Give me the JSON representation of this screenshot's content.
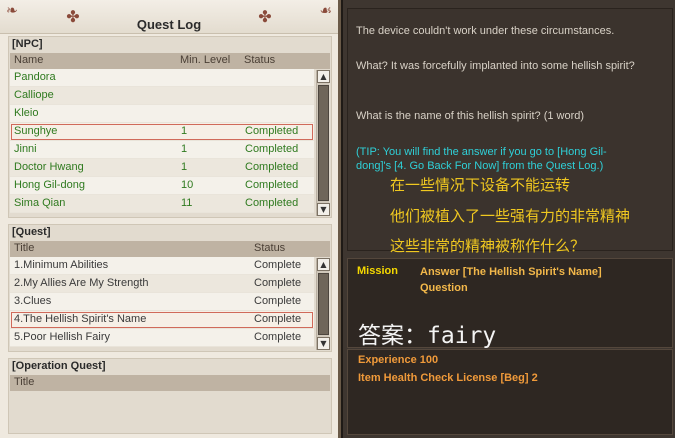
{
  "quest_log": {
    "title": "Quest Log",
    "npc": {
      "section_title": "[NPC]",
      "columns": {
        "name": "Name",
        "level": "Min. Level",
        "status": "Status"
      },
      "rows": [
        {
          "name": "Pandora",
          "level": "",
          "status": ""
        },
        {
          "name": "Calliope",
          "level": "",
          "status": ""
        },
        {
          "name": "Kleio",
          "level": "",
          "status": ""
        },
        {
          "name": "Sunghye",
          "level": "1",
          "status": "Completed"
        },
        {
          "name": "Jinni",
          "level": "1",
          "status": "Completed"
        },
        {
          "name": "Doctor Hwang",
          "level": "1",
          "status": "Completed"
        },
        {
          "name": "Hong Gil-dong",
          "level": "10",
          "status": "Completed"
        },
        {
          "name": "Sima Qian",
          "level": "11",
          "status": "Completed"
        }
      ]
    },
    "quest": {
      "section_title": "[Quest]",
      "columns": {
        "title": "Title",
        "status": "Status"
      },
      "rows": [
        {
          "title": "1.Minimum Abilities",
          "status": "Complete"
        },
        {
          "title": "2.My Allies Are My Strength",
          "status": "Complete"
        },
        {
          "title": "3.Clues",
          "status": "Complete"
        },
        {
          "title": "4.The Hellish Spirit's Name",
          "status": "Complete"
        },
        {
          "title": "5.Poor Hellish Fairy",
          "status": "Complete"
        }
      ]
    },
    "operation": {
      "section_title": "[Operation Quest]",
      "columns": {
        "title": "Title"
      }
    }
  },
  "dialog": {
    "line1": "The device couldn't work under these circumstances.",
    "line2": "What? It was forcefully implanted into some hellish spirit?",
    "line3": "What is the name of this hellish spirit? (1 word)",
    "tip": "(TIP: You will find the answer if you go to [Hong Gil-dong]'s [4. Go Back For Now] from the Quest Log.)",
    "cn1": "在一些情况下设备不能运转",
    "cn2": "他们被植入了一些强有力的非常精神",
    "cn3": "这些非常的精神被称作什么？"
  },
  "mission": {
    "label": "Mission",
    "text": "Answer [The Hellish Spirit's Name] Question",
    "answer": "答案：fairy"
  },
  "rewards": {
    "exp": "Experience 100",
    "item": "Item Health Check License [Beg] 2"
  }
}
